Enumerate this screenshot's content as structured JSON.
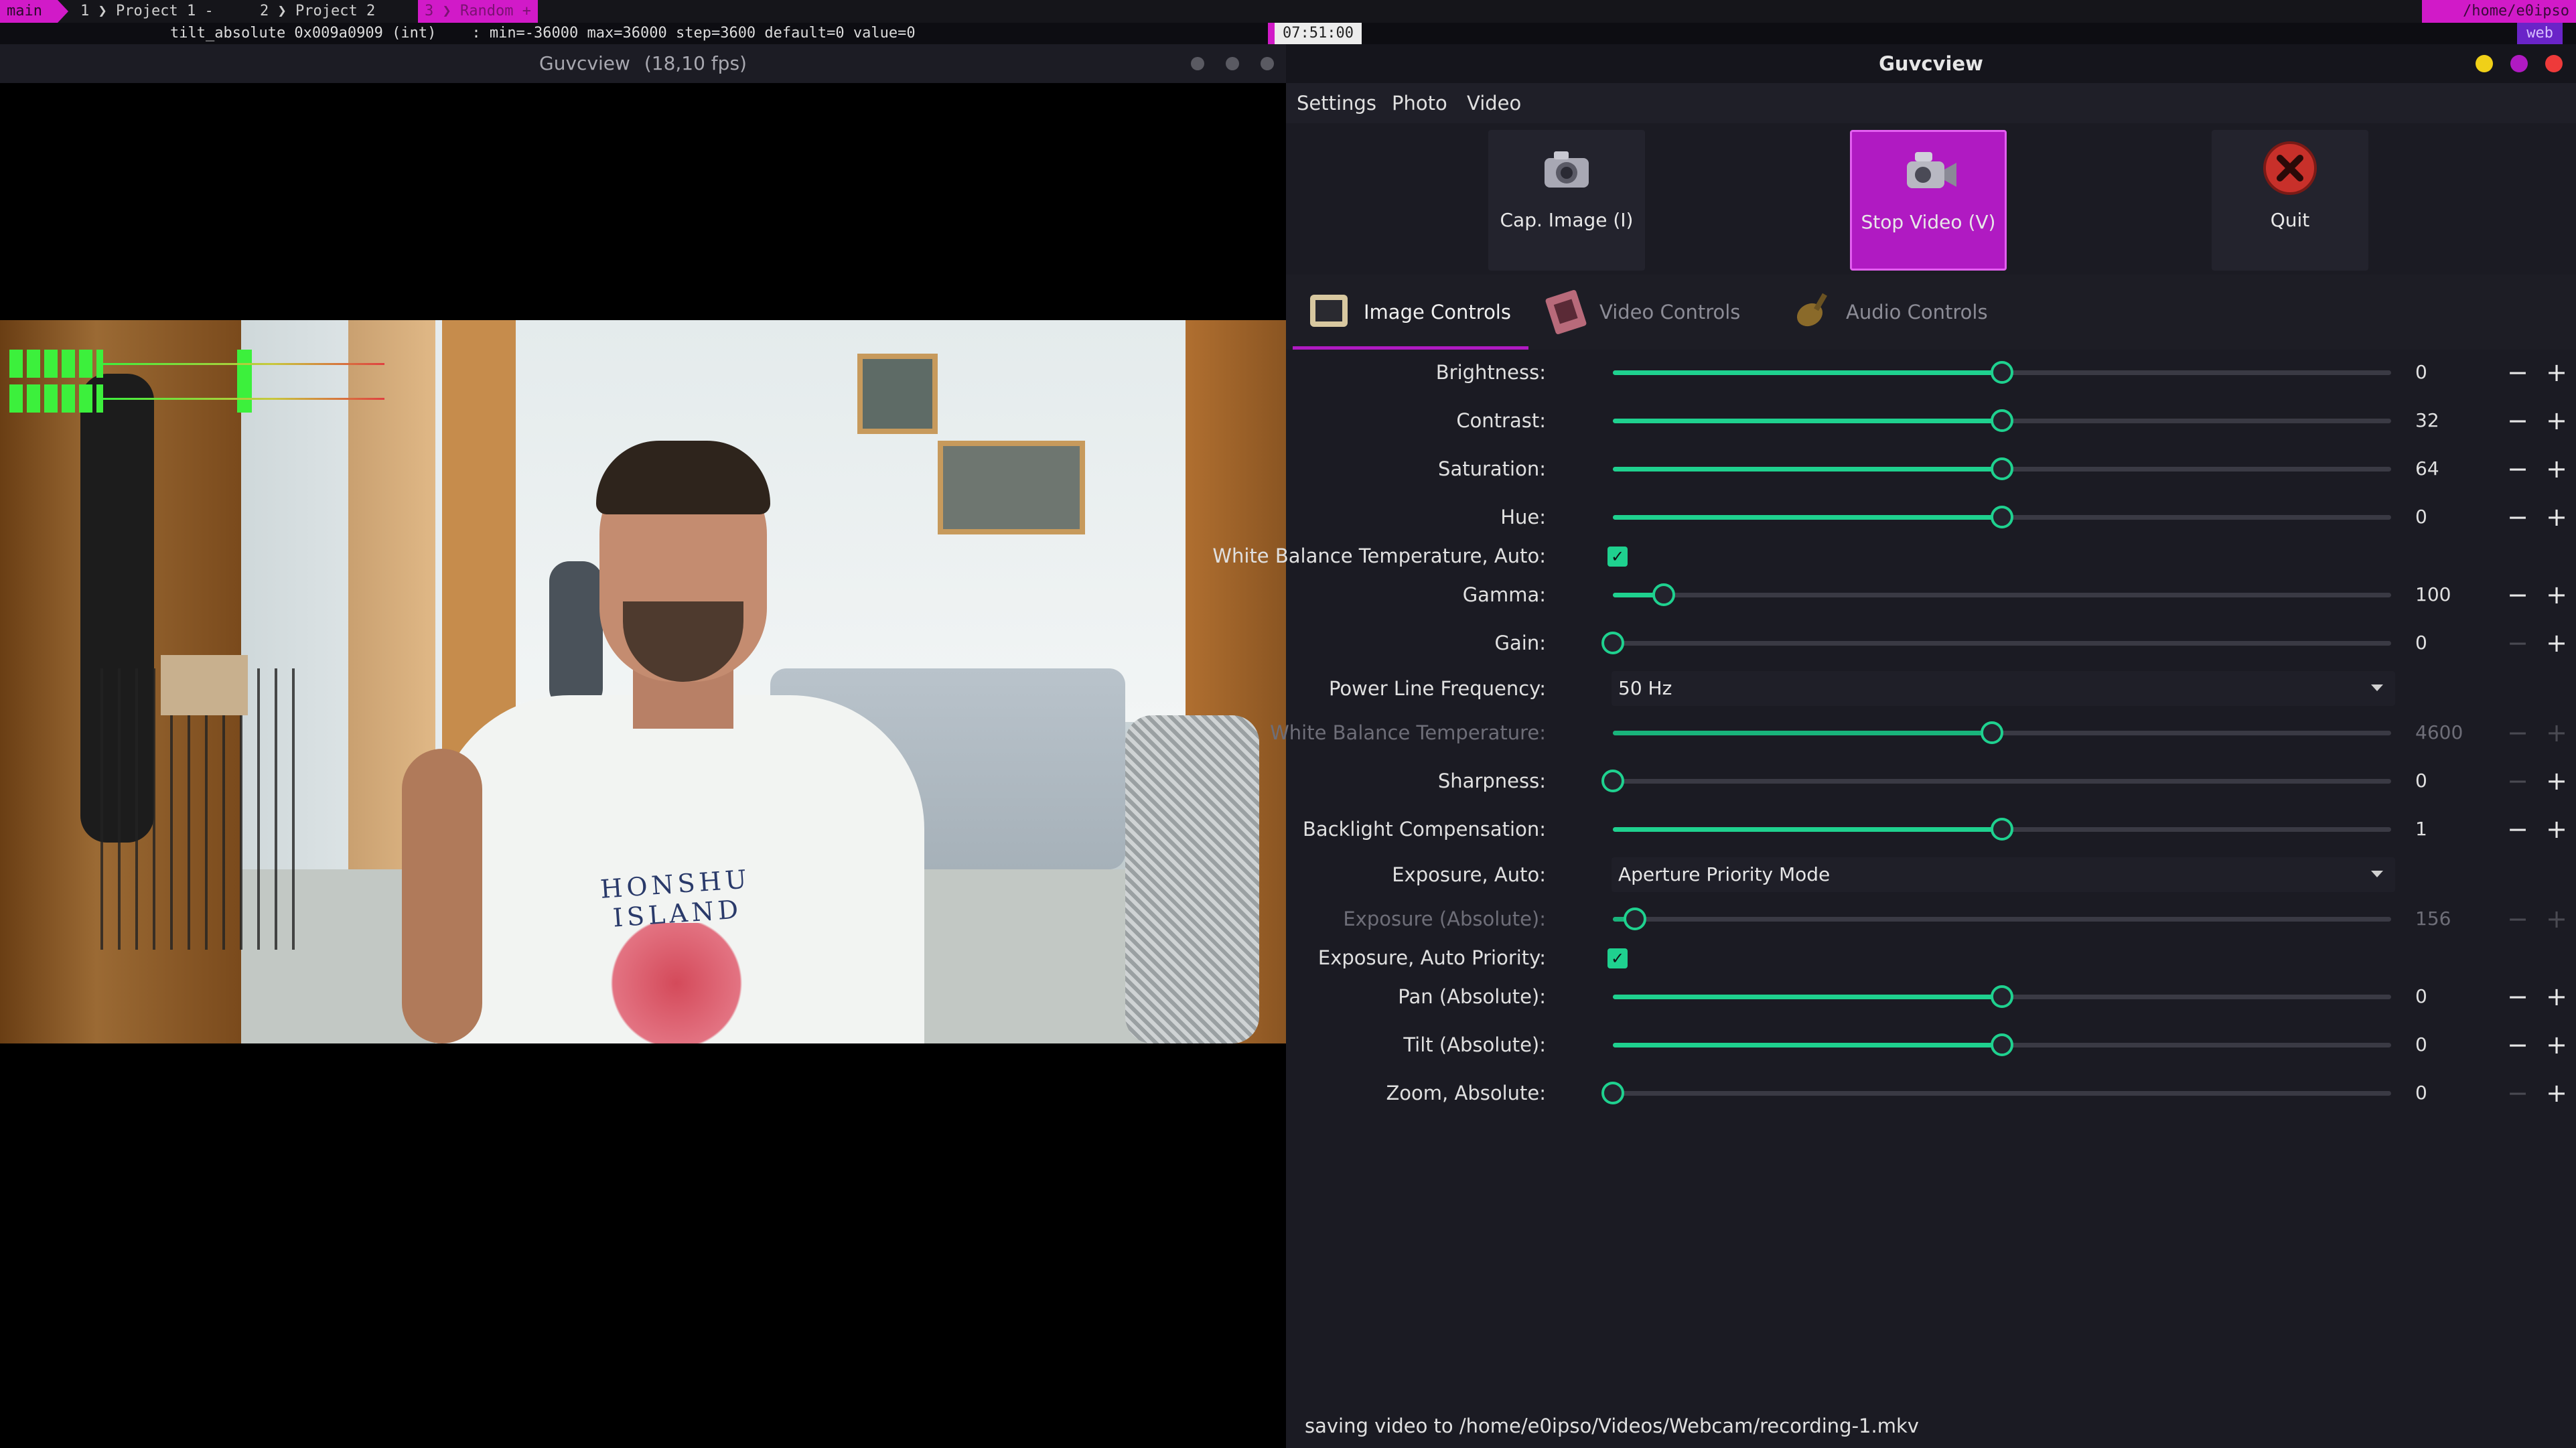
{
  "tmux": {
    "session": "main",
    "windows": [
      {
        "index": "1",
        "name": "Project 1 -"
      },
      {
        "index": "2",
        "name": "Project 2"
      },
      {
        "index": "3",
        "name": "Random +"
      }
    ],
    "cwd": "/home/e0ipso",
    "host": "web",
    "clock": "07:51:00",
    "control_line": "tilt_absolute 0x009a0909 (int)    : min=-36000 max=36000 step=3600 default=0 value=0",
    "colors": {
      "accent": "#d11ac8",
      "bg": "#15151a"
    }
  },
  "preview_window": {
    "title": "Guvcview",
    "fps": "(18,10 fps)",
    "shirt_text": "HONSHU ISLAND"
  },
  "control_window": {
    "title": "Guvcview",
    "menu": [
      "Settings",
      "Photo",
      "Video"
    ],
    "toolbar": {
      "capture_image": "Cap. Image (I)",
      "stop_video": "Stop Video (V)",
      "quit": "Quit"
    },
    "tabs": {
      "image": "Image Controls",
      "video": "Video Controls",
      "audio": "Audio Controls"
    },
    "controls": {
      "brightness": {
        "label": "Brightness:",
        "value": "0",
        "position": 0.5
      },
      "contrast": {
        "label": "Contrast:",
        "value": "32",
        "position": 0.5
      },
      "saturation": {
        "label": "Saturation:",
        "value": "64",
        "position": 0.5
      },
      "hue": {
        "label": "Hue:",
        "value": "0",
        "position": 0.5
      },
      "wb_auto": {
        "label": "White Balance Temperature, Auto:",
        "checked": true
      },
      "gamma": {
        "label": "Gamma:",
        "value": "100",
        "position": 0.065
      },
      "gain": {
        "label": "Gain:",
        "value": "0",
        "position": 0.0
      },
      "power_line": {
        "label": "Power Line Frequency:",
        "value": "50 Hz"
      },
      "wb_temp": {
        "label": "White Balance Temperature:",
        "value": "4600",
        "position": 0.487
      },
      "sharpness": {
        "label": "Sharpness:",
        "value": "0",
        "position": 0.0
      },
      "backlight": {
        "label": "Backlight Compensation:",
        "value": "1",
        "position": 0.5
      },
      "exposure_auto": {
        "label": "Exposure, Auto:",
        "value": "Aperture Priority Mode"
      },
      "exposure_abs": {
        "label": "Exposure (Absolute):",
        "value": "156",
        "position": 0.028
      },
      "exposure_priority": {
        "label": "Exposure, Auto Priority:",
        "checked": true
      },
      "pan": {
        "label": "Pan (Absolute):",
        "value": "0",
        "position": 0.5
      },
      "tilt": {
        "label": "Tilt (Absolute):",
        "value": "0",
        "position": 0.5
      },
      "zoom": {
        "label": "Zoom, Absolute:",
        "value": "0",
        "position": 0.0
      }
    },
    "status": "saving video to /home/e0ipso/Videos/Webcam/recording-1.mkv",
    "colors": {
      "slider": "#1fd18f",
      "active_button": "#b01ac2"
    }
  }
}
